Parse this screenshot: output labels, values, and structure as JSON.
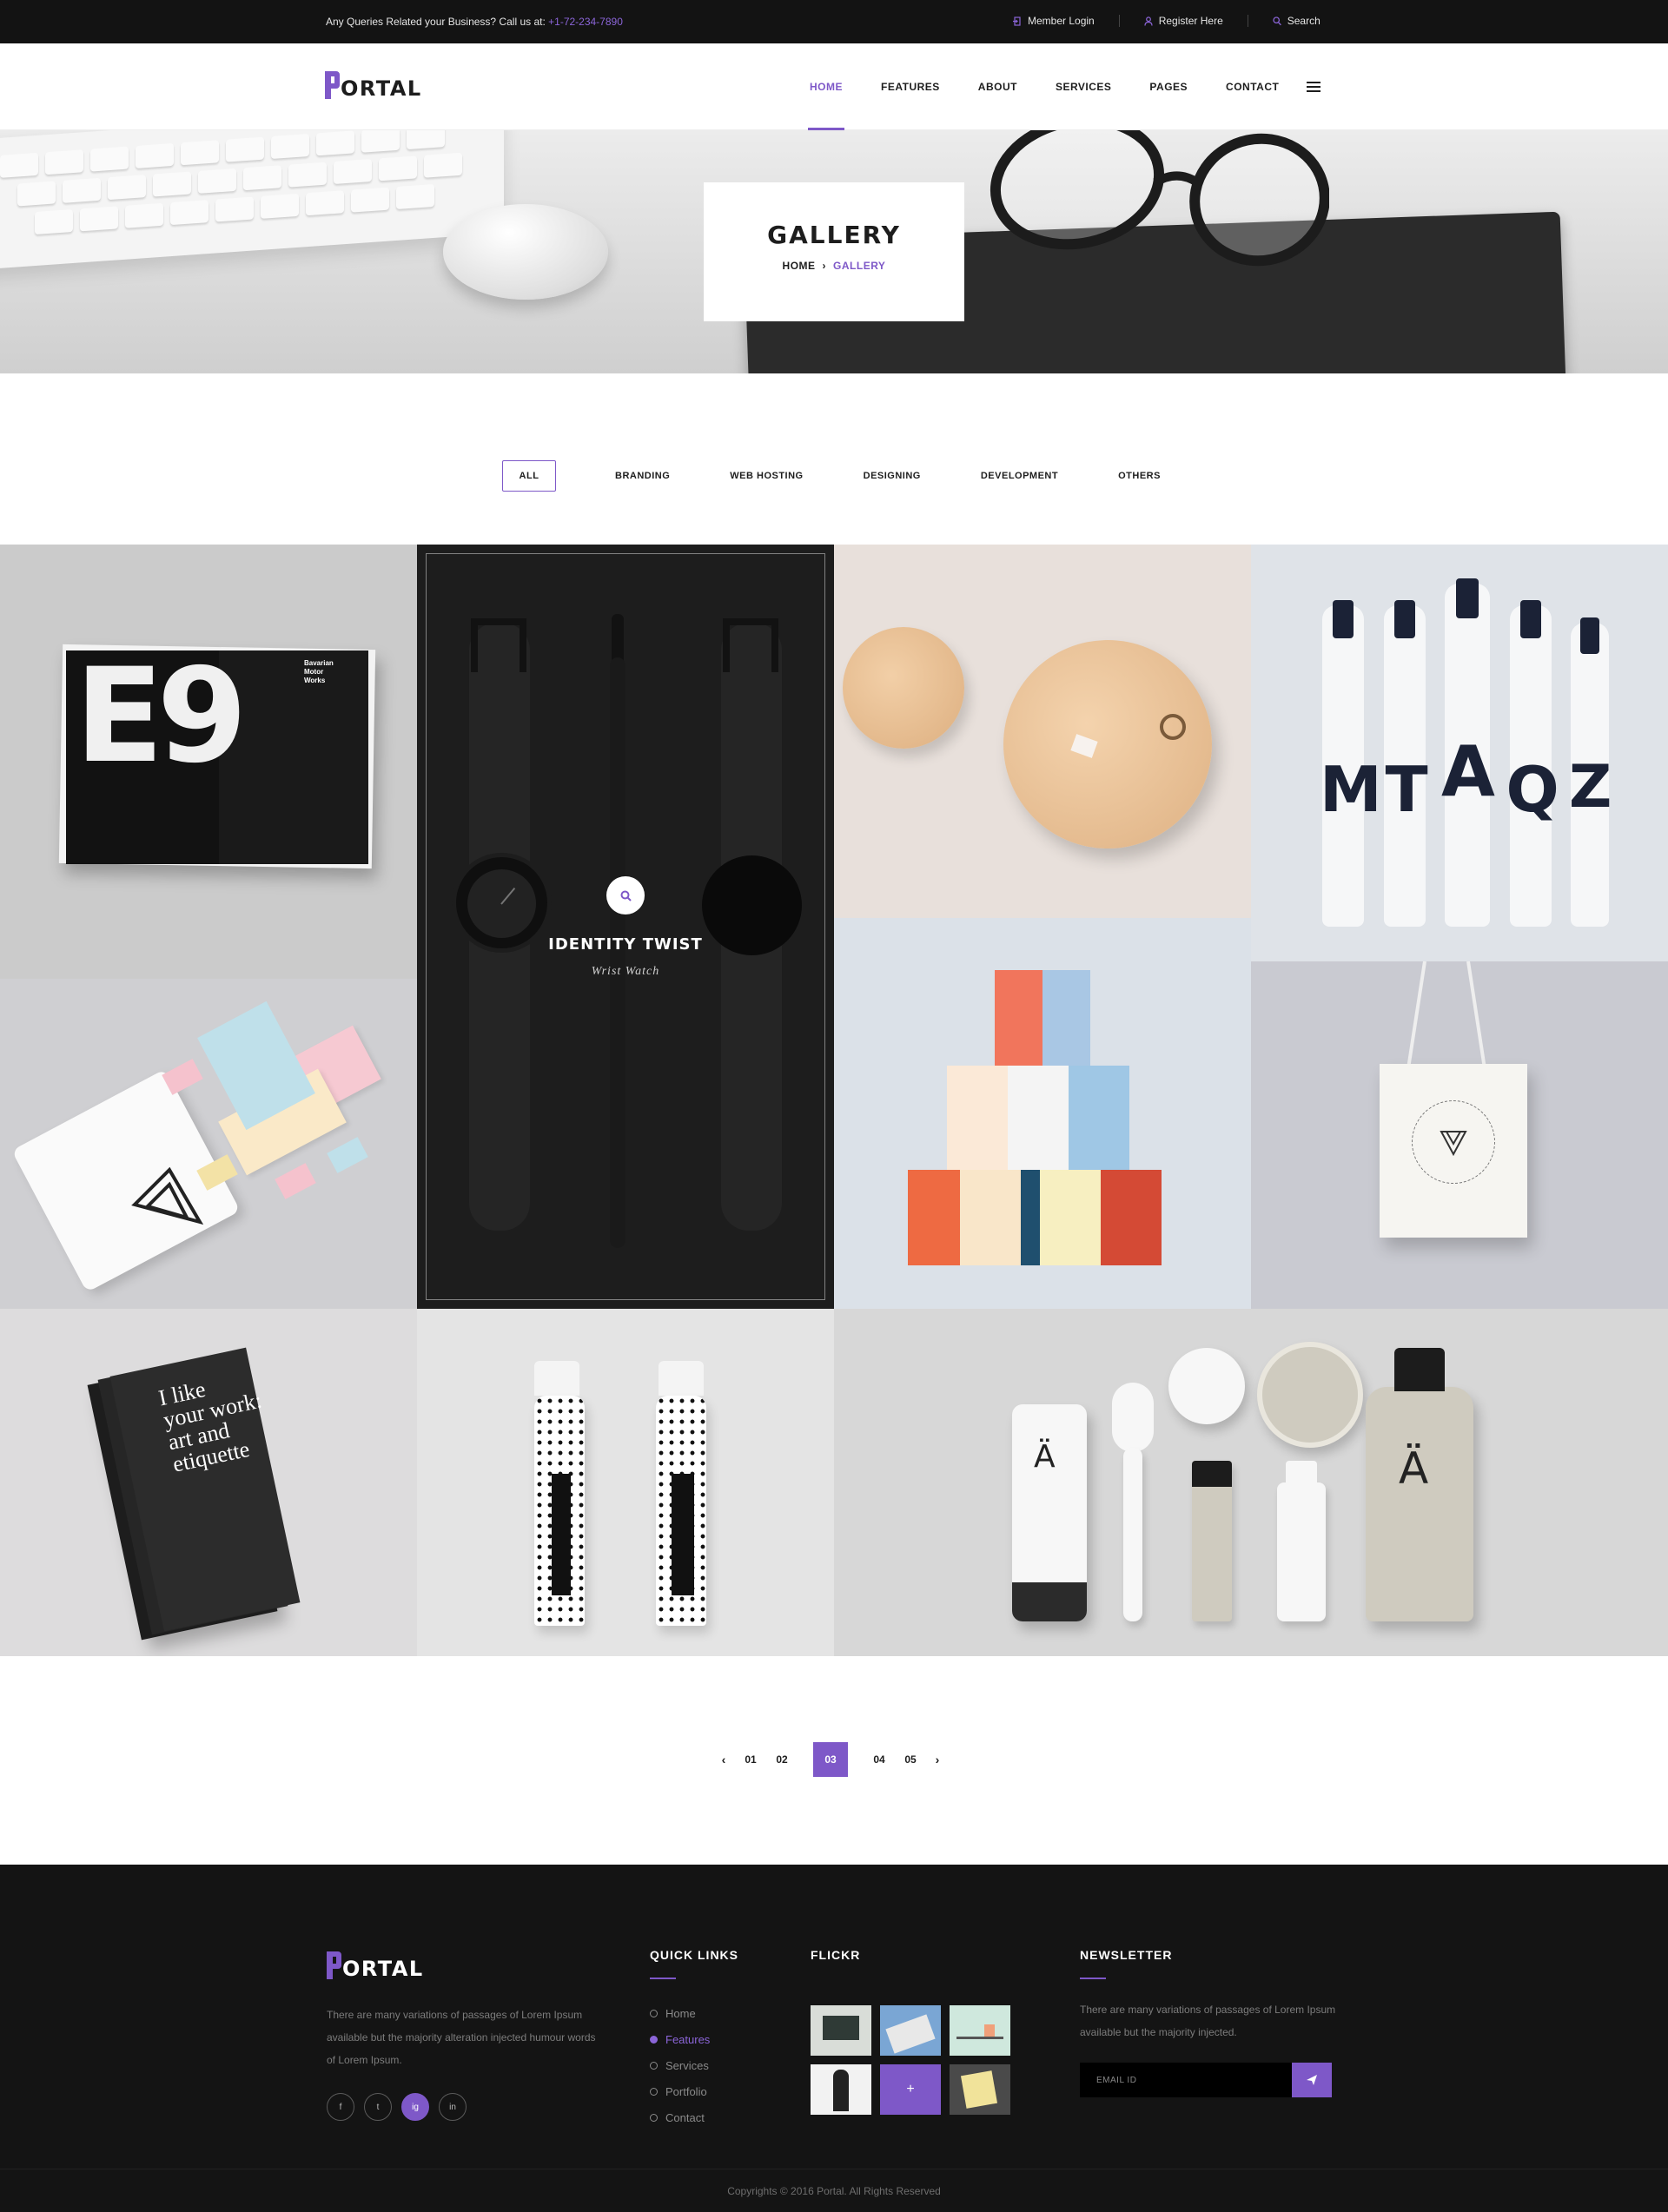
{
  "topbar": {
    "query_text": "Any Queries Related your Business? Call us at:",
    "phone": "+1-72-234-7890",
    "member_login": "Member Login",
    "register": "Register Here",
    "search": "Search"
  },
  "header": {
    "logo": "ORTAL",
    "nav": [
      "HOME",
      "FEATURES",
      "ABOUT",
      "SERVICES",
      "PAGES",
      "CONTACT"
    ],
    "active_nav": "HOME",
    "menu_icon": "hamburger-icon"
  },
  "hero": {
    "title": "GALLERY",
    "breadcrumb_home": "HOME",
    "breadcrumb_sep": "›",
    "breadcrumb_current": "GALLERY"
  },
  "filters": {
    "items": [
      "ALL",
      "BRANDING",
      "WEB HOSTING",
      "DESIGNING",
      "DEVELOPMENT",
      "OTHERS"
    ],
    "active": "ALL"
  },
  "gallery": {
    "featured_title": "IDENTITY TWIST",
    "featured_subtitle": "Wrist Watch",
    "featured_icon": "search-icon",
    "book_text": "E9",
    "book_side_text": [
      "Bavarian",
      "Motor",
      "Works"
    ],
    "bottles_letters": [
      "M",
      "T",
      "A",
      "Q",
      "Z"
    ],
    "brochure_text": [
      "I like",
      "your work:",
      "art and",
      "etiquette"
    ],
    "cosmetic_letter": "Ä"
  },
  "pagination": {
    "prev": "‹",
    "pages": [
      "01",
      "02",
      "03",
      "04",
      "05"
    ],
    "active": "03",
    "next": "›"
  },
  "footer": {
    "logo": "ORTAL",
    "about": "There are many variations of passages of Lorem Ipsum available but the majority alteration injected humour words of Lorem Ipsum.",
    "social": [
      "f",
      "t",
      "ig",
      "in"
    ],
    "quick_links_title": "QUICK LINKS",
    "quick_links": [
      "Home",
      "Features",
      "Services",
      "Portfolio",
      "Contact"
    ],
    "quick_links_active": "Features",
    "flickr_title": "FLICKR",
    "newsletter_title": "NEWSLETTER",
    "newsletter_text": "There are many variations of passages of Lorem Ipsum available but the majority injected.",
    "email_placeholder": "EMAIL ID",
    "send_icon": "paper-plane-icon",
    "copyright": "Copyrights © 2016 Portal. All Rights Reserved"
  },
  "colors": {
    "accent": "#7e58c8",
    "topbar_bg": "#131313",
    "footer_bg": "#141414"
  }
}
